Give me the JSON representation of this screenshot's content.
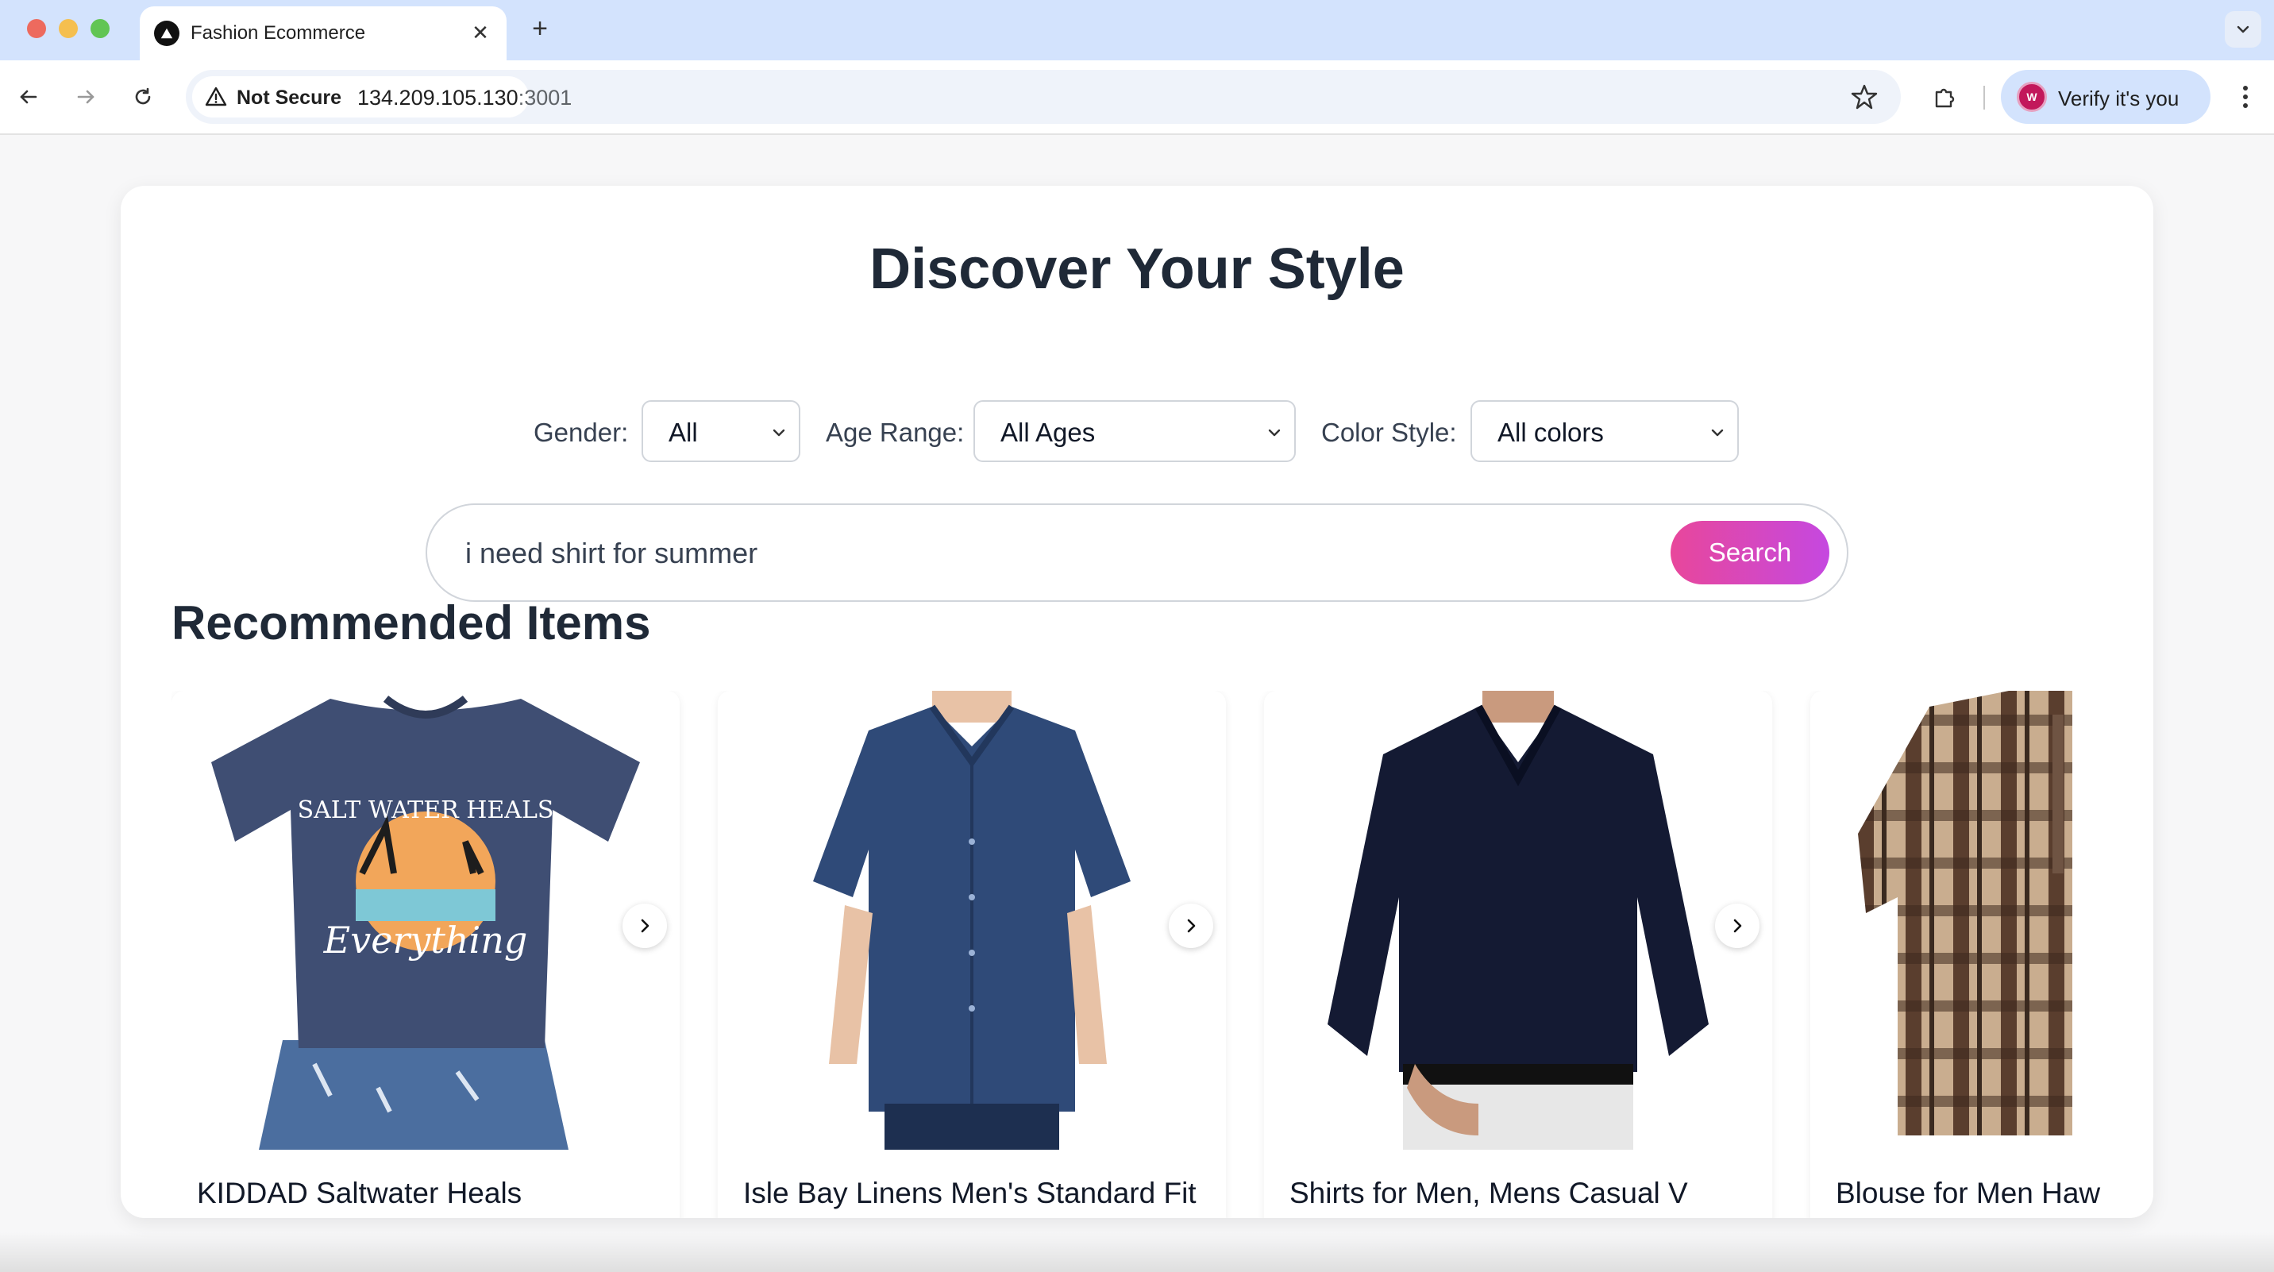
{
  "browser": {
    "tab_title": "Fashion Ecommerce",
    "tab_close": "✕",
    "new_tab": "+",
    "security_label": "Not Secure",
    "url_host": "134.209.105.130",
    "url_port": ":3001",
    "profile_label": "Verify it's you",
    "profile_initial": "W"
  },
  "page": {
    "title": "Discover Your Style",
    "filters": {
      "gender_label": "Gender:",
      "gender_value": "All",
      "age_label": "Age Range:",
      "age_value": "All Ages",
      "color_label": "Color Style:",
      "color_value": "All colors"
    },
    "search": {
      "query": "i need shirt for summer",
      "button_label": "Search"
    },
    "section_title": "Recommended Items",
    "products": [
      {
        "name": "KIDDAD Saltwater Heals",
        "graphic_top": "SALT WATER HEALS",
        "graphic_bottom": "Everything"
      },
      {
        "name": "Isle Bay Linens Men's Standard Fit"
      },
      {
        "name": "Shirts for Men, Mens Casual V"
      },
      {
        "name": "Blouse for Men Haw"
      }
    ]
  },
  "colors": {
    "accent_start": "#e8479b",
    "accent_end": "#c548e0",
    "tab_bar": "#d3e3fd"
  }
}
